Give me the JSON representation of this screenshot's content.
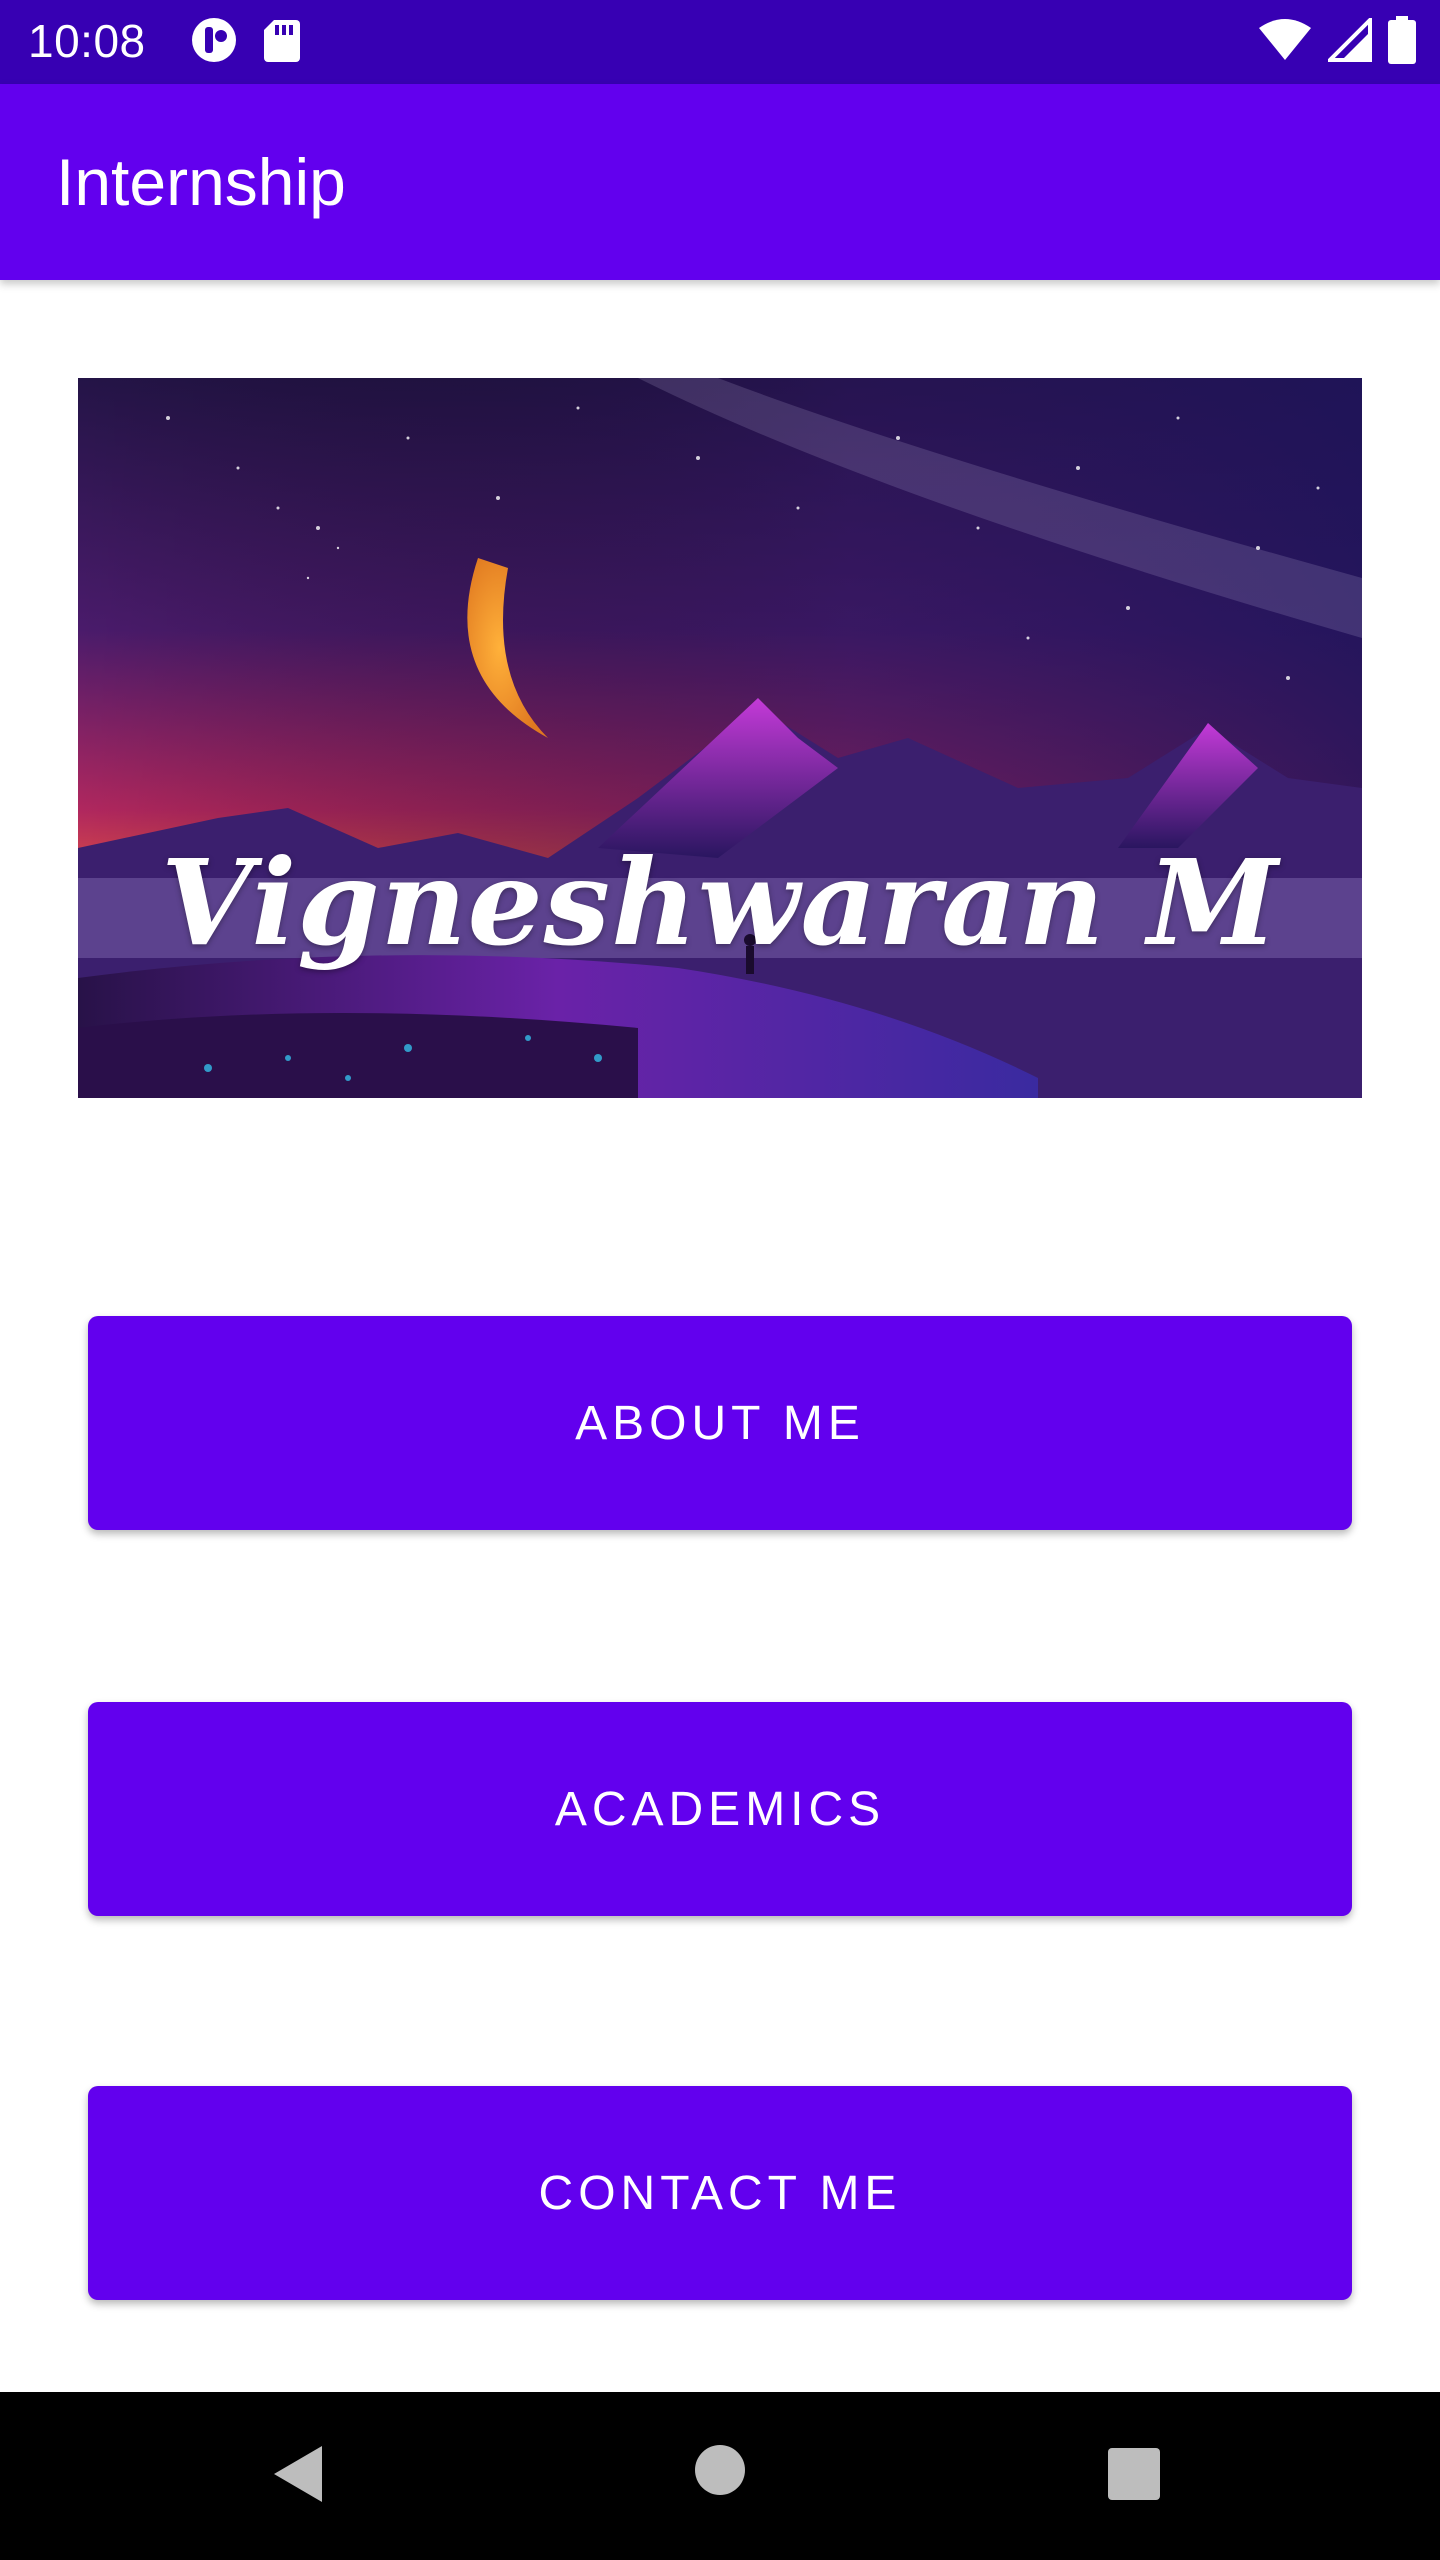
{
  "status_bar": {
    "time": "10:08",
    "icons": [
      "notification-app-icon",
      "sd-card-icon",
      "wifi-icon",
      "cell-signal-icon",
      "battery-icon"
    ],
    "background": "#3700B3"
  },
  "app_bar": {
    "title": "Internship",
    "background": "#6200EE"
  },
  "banner": {
    "name_text": "Vigneshwaran M"
  },
  "buttons": {
    "about_label": "ABOUT ME",
    "academics_label": "ACADEMICS",
    "contact_label": "CONTACT ME",
    "color": "#6200EE"
  },
  "nav_bar": {
    "icons": [
      "back-icon",
      "home-icon",
      "recents-icon"
    ]
  }
}
